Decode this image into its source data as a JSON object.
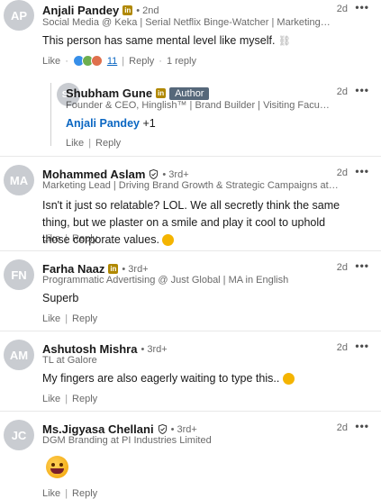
{
  "comments": [
    {
      "name": "Anjali Pandey",
      "degree": "• 2nd",
      "headline": "Social Media @ Keka | Serial Netflix Binge-Watcher | Marketing & Content En...",
      "time": "2d",
      "text": "This person has same mental level like myself.",
      "like": "Like",
      "reaction_count": "11",
      "reply": "Reply",
      "reply_count": "1 reply"
    },
    {
      "name": "Shubham Gune",
      "author_badge": "Author",
      "headline": "Founder & CEO, Hinglish™ | Brand Builder | Visiting Faculty, St. Xavier's ...",
      "time": "2d",
      "mention": "Anjali Pandey",
      "text_suffix": "+1",
      "like": "Like",
      "reply": "Reply"
    },
    {
      "name": "Mohammed Aslam",
      "degree": "• 3rd+",
      "headline": "Marketing Lead | Driving Brand Growth & Strategic Campaigns at HAQUM Co.",
      "time": "2d",
      "text": "Isn't it just so relatable? LOL. We all secretly think the same thing, but we plaster on a smile and play it cool to uphold those corporate values.",
      "like": "Like",
      "reply": "Reply"
    },
    {
      "name": "Farha Naaz",
      "degree": "• 3rd+",
      "headline": "Programmatic Advertising @ Just Global | MA in English",
      "time": "2d",
      "text": "Superb",
      "like": "Like",
      "reply": "Reply"
    },
    {
      "name": "Ashutosh Mishra",
      "degree": "• 3rd+",
      "headline": "TL at Galore",
      "time": "2d",
      "text": "My fingers are also eagerly waiting to type this..",
      "like": "Like",
      "reply": "Reply"
    },
    {
      "name": "Ms.Jigyasa Chellani",
      "degree": "• 3rd+",
      "headline": "DGM Branding at PI Industries Limited",
      "time": "2d",
      "like": "Like",
      "reply": "Reply"
    }
  ],
  "more_icon": "•••",
  "colors": {
    "link": "#0a66c2",
    "linkedin_badge": "#b08800",
    "author_badge": "#56687a"
  }
}
